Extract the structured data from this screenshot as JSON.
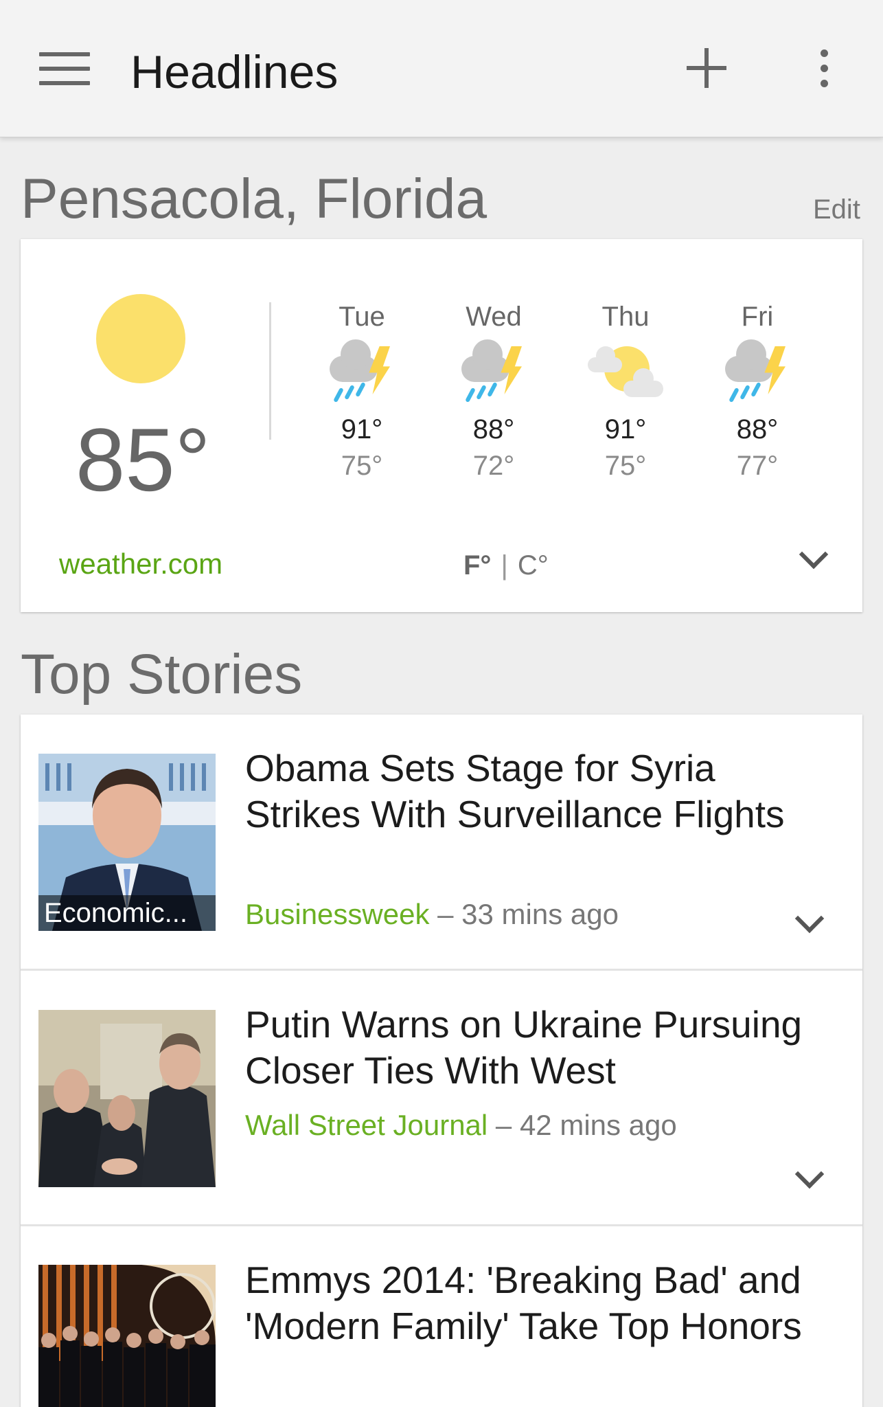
{
  "app_bar": {
    "title": "Headlines",
    "menu_icon": "hamburger-menu-icon",
    "add_icon": "plus-icon",
    "more_icon": "overflow-dots-icon"
  },
  "location": {
    "name": "Pensacola, Florida",
    "edit_label": "Edit"
  },
  "weather": {
    "current_icon": "sunny-icon",
    "current_temp": "85°",
    "forecast": [
      {
        "day": "Tue",
        "icon": "thunderstorm-icon",
        "high": "91°",
        "low": "75°"
      },
      {
        "day": "Wed",
        "icon": "thunderstorm-icon",
        "high": "88°",
        "low": "72°"
      },
      {
        "day": "Thu",
        "icon": "partly-cloudy-icon",
        "high": "91°",
        "low": "75°"
      },
      {
        "day": "Fri",
        "icon": "thunderstorm-icon",
        "high": "88°",
        "low": "77°"
      }
    ],
    "source": "weather.com",
    "unit_f": "F°",
    "unit_sep": "|",
    "unit_c": "C°",
    "selected_unit": "F°"
  },
  "top_stories": {
    "title": "Top Stories",
    "items": [
      {
        "headline": "Obama Sets Stage for Syria Strikes With Surveillance Flights",
        "thumb_label": "Economic...",
        "source": "Businessweek",
        "age": "– 33 mins ago"
      },
      {
        "headline": "Putin Warns on Ukraine Pursuing Closer Ties With West",
        "thumb_label": "",
        "source": "Wall Street Journal",
        "age": "– 42 mins ago"
      },
      {
        "headline": "Emmys 2014: 'Breaking Bad' and 'Modern Family' Take Top Honors",
        "thumb_label": "",
        "source": "",
        "age": ""
      }
    ]
  },
  "colors": {
    "accent_green": "#5aa514",
    "sun_yellow": "#fbe06b",
    "rain_blue": "#3fb7e8"
  }
}
